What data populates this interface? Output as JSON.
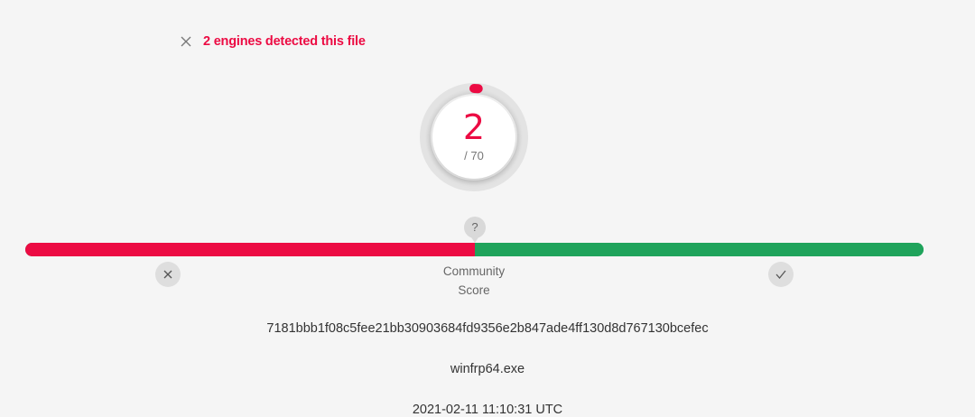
{
  "detection": {
    "title": "2 engines detected this file",
    "close_icon": "close-icon"
  },
  "score": {
    "detected": "2",
    "total_label": "/ 70",
    "detected_value": 2,
    "total_value": 70
  },
  "community": {
    "help_icon_text": "?",
    "label_line1": "Community",
    "label_line2": "Score",
    "score_fraction": 0.5,
    "downvote_icon": "close-icon",
    "upvote_icon": "check-icon"
  },
  "file": {
    "hash": "7181bbb1f08c5fee21bb30903684fd9356e2b847ade4ff130d8d767130bcefec",
    "name": "winfrp64.exe",
    "date": "2021-02-11 11:10:31 UTC"
  },
  "colors": {
    "malicious": "#ec0b43",
    "harmless": "#1fa35b"
  }
}
